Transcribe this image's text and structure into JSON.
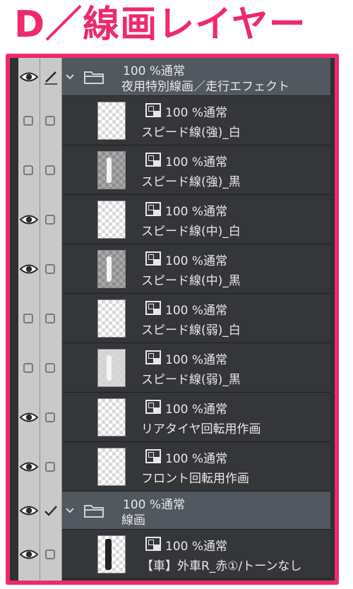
{
  "page_title": "D／線画レイヤー",
  "layers": [
    {
      "kind": "folder",
      "blend": "100 %通常",
      "name": "夜用特別線画／走行エフェクト",
      "visible": true,
      "edit_icon": "pen"
    },
    {
      "kind": "layer",
      "blend": "100 %通常",
      "name": "スピード線(強)_白",
      "visible": false,
      "thumb": "light"
    },
    {
      "kind": "layer",
      "blend": "100 %通常",
      "name": "スピード線(強)_黒",
      "visible": false,
      "thumb": "dark"
    },
    {
      "kind": "layer",
      "blend": "100 %通常",
      "name": "スピード線(中)_白",
      "visible": true,
      "thumb": "light"
    },
    {
      "kind": "layer",
      "blend": "100 %通常",
      "name": "スピード線(中)_黒",
      "visible": true,
      "thumb": "dark"
    },
    {
      "kind": "layer",
      "blend": "100 %通常",
      "name": "スピード線(弱)_白",
      "visible": false,
      "thumb": "light"
    },
    {
      "kind": "layer",
      "blend": "100 %通常",
      "name": "スピード線(弱)_黒",
      "visible": false,
      "thumb": "mid"
    },
    {
      "kind": "layer",
      "blend": "100 %通常",
      "name": "リアタイヤ回転用作画",
      "visible": true,
      "thumb": "light"
    },
    {
      "kind": "layer",
      "blend": "100 %通常",
      "name": "フロント回転用作画",
      "visible": true,
      "thumb": "light"
    },
    {
      "kind": "folder",
      "blend": "100 %通常",
      "name": "線画",
      "visible": true,
      "edit_icon": "check"
    },
    {
      "kind": "layer",
      "blend": "100 %通常",
      "name": "【車】外車R_赤①/トーンなし",
      "visible": true,
      "thumb": "car"
    }
  ],
  "colors": {
    "accent": "#ee2a6b",
    "panel": "#2f3033",
    "folder_row": "#525860",
    "layer_row": "#35363a",
    "visibility_column": "#c9c9c9"
  }
}
